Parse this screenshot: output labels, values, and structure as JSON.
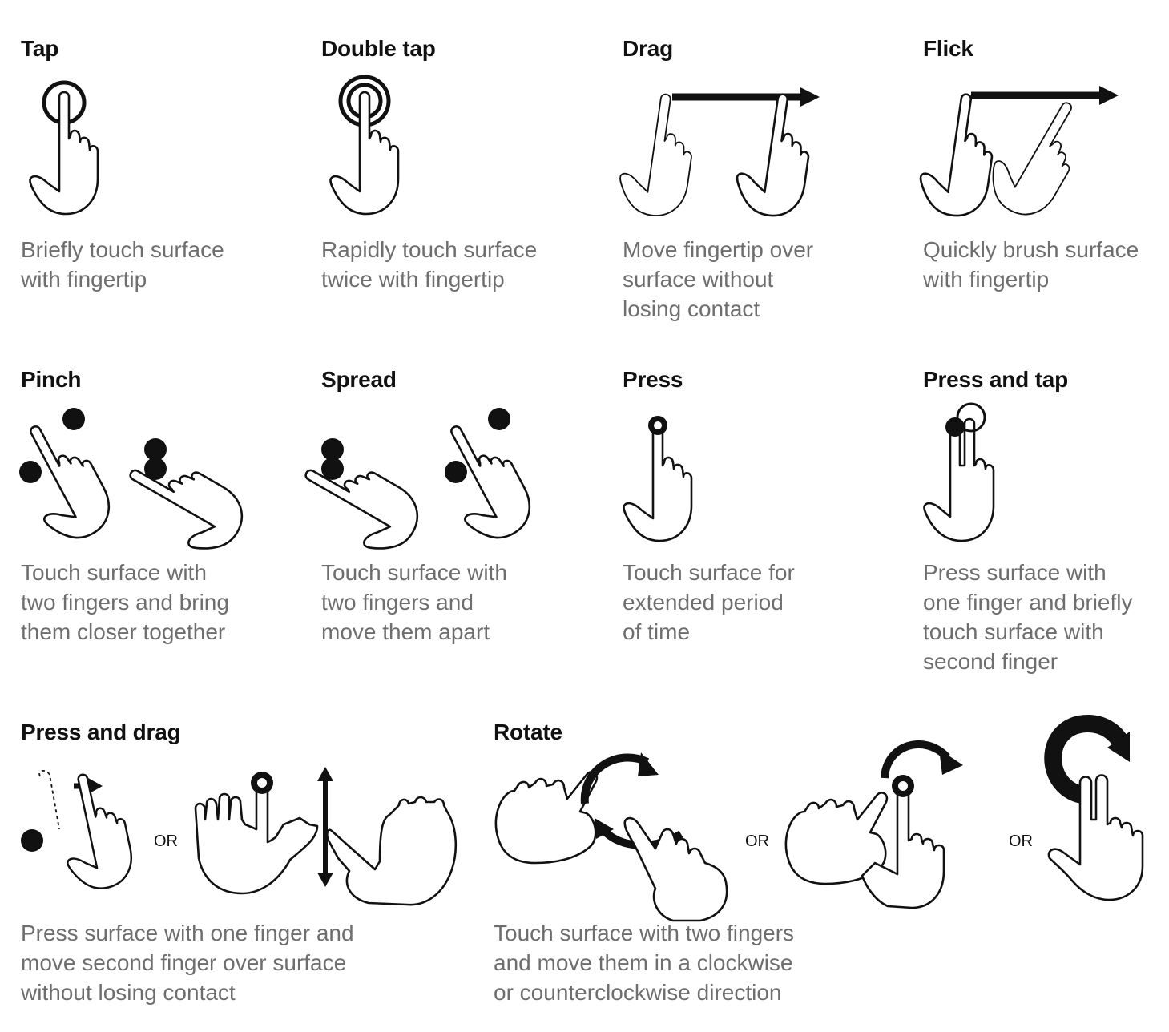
{
  "gestures": [
    {
      "key": "tap",
      "title": "Tap",
      "description": "Briefly touch surface\nwith fingertip"
    },
    {
      "key": "double_tap",
      "title": "Double tap",
      "description": "Rapidly touch surface\ntwice with fingertip"
    },
    {
      "key": "drag",
      "title": "Drag",
      "description": "Move fingertip over\nsurface without\nlosing contact"
    },
    {
      "key": "flick",
      "title": "Flick",
      "description": "Quickly brush surface\nwith fingertip"
    },
    {
      "key": "pinch",
      "title": "Pinch",
      "description": "Touch surface with\ntwo fingers and bring\nthem closer together"
    },
    {
      "key": "spread",
      "title": "Spread",
      "description": "Touch surface with\ntwo fingers and\nmove them apart"
    },
    {
      "key": "press",
      "title": "Press",
      "description": "Touch surface for\nextended period\nof time"
    },
    {
      "key": "press_and_tap",
      "title": "Press and tap",
      "description": "Press surface with\none finger and briefly\ntouch surface with\nsecond finger"
    },
    {
      "key": "press_and_drag",
      "title": "Press and drag",
      "description": "Press surface with one finger and\nmove second finger over surface\nwithout losing contact"
    },
    {
      "key": "rotate",
      "title": "Rotate",
      "description": "Touch surface with two fingers\nand move them in a clockwise\nor counterclockwise direction"
    }
  ],
  "or_label": "OR",
  "colors": {
    "title": "#111111",
    "description": "#6e6e6e",
    "ink": "#111111",
    "background": "#ffffff"
  }
}
